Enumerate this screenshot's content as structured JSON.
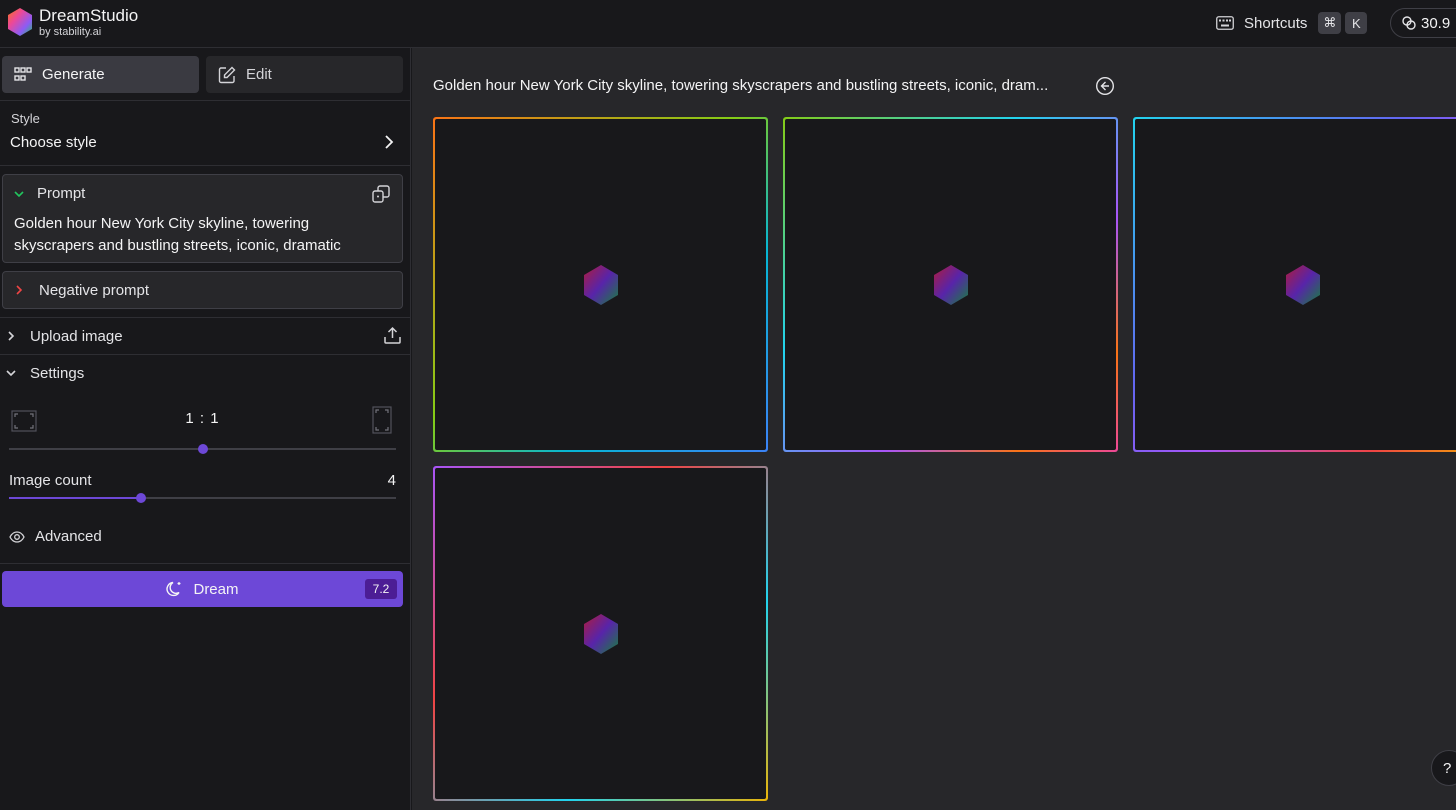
{
  "app": {
    "name": "DreamStudio",
    "byline": "by stability.ai"
  },
  "topbar": {
    "shortcuts_label": "Shortcuts",
    "shortcut_keys": [
      "⌘",
      "K"
    ],
    "credits": "30.9"
  },
  "sidebar": {
    "tabs": [
      {
        "label": "Generate",
        "active": true
      },
      {
        "label": "Edit",
        "active": false
      }
    ],
    "style": {
      "label": "Style",
      "value": "Choose style"
    },
    "prompt": {
      "label": "Prompt",
      "text": "Golden hour New York City skyline, towering skyscrapers and bustling streets, iconic, dramatic"
    },
    "negative_prompt": {
      "label": "Negative prompt"
    },
    "upload_image": {
      "label": "Upload image"
    },
    "settings": {
      "label": "Settings",
      "aspect_ratio": "1 : 1",
      "aspect_slider_level": 0.5,
      "image_count_label": "Image count",
      "image_count": "4",
      "image_count_slider_level": 0.34,
      "advanced_label": "Advanced"
    },
    "dream": {
      "label": "Dream",
      "cost": "7.2"
    }
  },
  "main": {
    "prompt_title": "Golden hour New York City skyline, towering skyscrapers and bustling streets, iconic, dram...",
    "image_count": 4,
    "help_label": "?"
  },
  "colors": {
    "accent": "#6d48d7",
    "background": "#18181b",
    "panel": "#27272a"
  }
}
